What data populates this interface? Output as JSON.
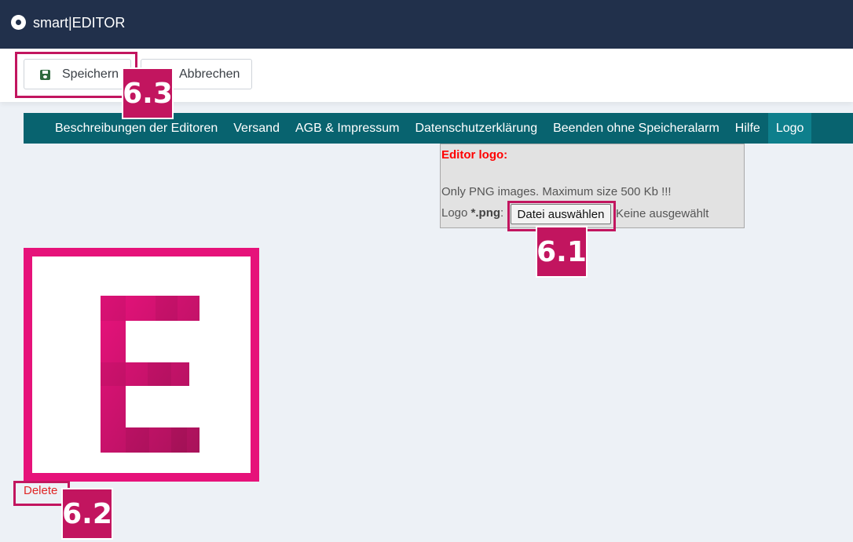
{
  "app": {
    "title": "smart|EDITOR"
  },
  "toolbar": {
    "save_label": "Speichern",
    "cancel_label": "Abbrechen"
  },
  "nav": {
    "items": [
      {
        "label": "Beschreibungen der Editoren"
      },
      {
        "label": "Versand"
      },
      {
        "label": "AGB & Impressum"
      },
      {
        "label": "Datenschutzerklärung"
      },
      {
        "label": "Beenden ohne Speicheralarm"
      },
      {
        "label": "Hilfe"
      },
      {
        "label": "Logo",
        "active": true
      }
    ]
  },
  "logo_panel": {
    "title": "Editor logo:",
    "hint": "Only PNG images. Maximum size 500 Kb !!!",
    "field_label_prefix": "Logo ",
    "field_label_ext": "*.png",
    "field_label_suffix": ":",
    "file_button": "Datei auswählen",
    "file_status": "Keine ausgewählt"
  },
  "preview": {
    "letter": "E",
    "delete_label": "Delete"
  },
  "annotations": {
    "m1": "6.1",
    "m2": "6.2",
    "m3": "6.3"
  },
  "colors": {
    "appbar": "#21304b",
    "nav": "#08636f",
    "nav_active": "#0e7f8c",
    "accent": "#c2155f",
    "logo_pink": "#e6127a",
    "panel_title": "#ff0000",
    "delete": "#e02525"
  },
  "icons": {
    "app": "circle-dot-icon",
    "save": "floppy-disk-icon",
    "cancel": "cancel-icon"
  }
}
